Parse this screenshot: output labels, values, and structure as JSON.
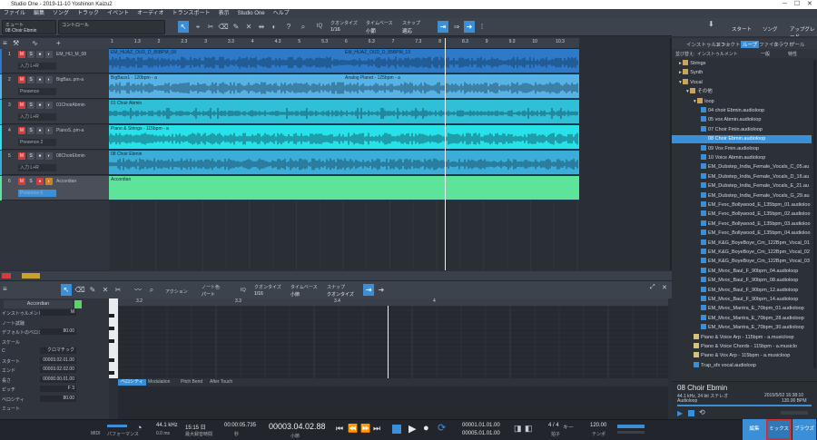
{
  "window": {
    "title": "Studio One - 2019-11-10 Yoshinon Kaizu2"
  },
  "menu": [
    "ファイル",
    "編集",
    "ソング",
    "トラック",
    "イベント",
    "オーディオ",
    "トランスポート",
    "表示",
    "Studio One",
    "ヘルプ"
  ],
  "toolbar": {
    "mute_label": "ミュート",
    "track_name": "08 Choir Ebmin",
    "control_label": "コントロール",
    "quantize_label": "クオンタイズ",
    "quantize_value": "1/16",
    "timebase_label": "タイムベース",
    "timebase_value": "小節",
    "snap_label": "スナップ",
    "snap_value": "適応"
  },
  "right_head": {
    "start": "スタート",
    "song": "ソング",
    "upgrade": "アップグレード"
  },
  "ruler_ticks": [
    "1",
    "1.3",
    "2",
    "2.3",
    "3",
    "3.3",
    "4",
    "4.3",
    "5",
    "5.3",
    "6",
    "6.3",
    "7",
    "7.3",
    "8",
    "8.3",
    "9",
    "9.3",
    "10",
    "10.3",
    "11"
  ],
  "tracks": [
    {
      "num": "1",
      "name": "EM_HIJ_M_08",
      "sub": "入力 L+R"
    },
    {
      "num": "2",
      "name": "BigBas..pm-a",
      "sub": "Presence"
    },
    {
      "num": "3",
      "name": "01ChoirAbmin",
      "sub": "入力 L+R"
    },
    {
      "num": "4",
      "name": "PianoS..pm-a",
      "sub": "Presence 2"
    },
    {
      "num": "5",
      "name": "08ChoirEbmin",
      "sub": "入力 L+R"
    },
    {
      "num": "6",
      "name": "Accordian",
      "sub": "Presence 6"
    }
  ],
  "clips": [
    {
      "label": "EM_HIJAZ_OUD_D_85BPM_08",
      "label2": "EM_HIJAZ_OUD_D_85BPM_19",
      "color": "#2f79c9"
    },
    {
      "label": "BigBass1 - 120bpm - a",
      "label2": "Analog Planet - 125bpm - a",
      "color": "#57b3e6"
    },
    {
      "label": "01 Choir Abmin",
      "label2": "",
      "color": "#2fc0d8"
    },
    {
      "label": "Piano & Strings - 115bpm - a",
      "label2": "",
      "color": "#28e2ea"
    },
    {
      "label": "08 Choir Ebmin",
      "label2": "",
      "color": "#3aaed8"
    },
    {
      "label": "Accordian",
      "label2": "",
      "color": "#5de39a"
    }
  ],
  "editor": {
    "instrument_name": "Accordian",
    "tool_labels": {
      "action": "アクション",
      "note_color": "ノート色",
      "note_color_val": "パート",
      "quantize": "クオンタイズ",
      "quantize_val": "1/16",
      "timebase": "タイムベース",
      "timebase_val": "小節",
      "snap": "スナップ",
      "snap_val": "クオンタイズ"
    },
    "ruler": [
      "3.2",
      "3.3",
      "3.4",
      "4"
    ],
    "props": [
      {
        "label": "インストゥルメント",
        "value": "M"
      },
      {
        "label": "ノート試聴",
        "value": ""
      },
      {
        "label": "デフォルトのベロシティ",
        "value": "80.00"
      },
      {
        "label": "スケール",
        "value": ""
      },
      {
        "label": "C",
        "value": "クロマチック"
      },
      {
        "label": "スタート",
        "value": "00003.02.01.00"
      },
      {
        "label": "エンド",
        "value": "00003.02.02.00"
      },
      {
        "label": "長さ",
        "value": "00000.00.01.00"
      },
      {
        "label": "ピッチ",
        "value": "F 3"
      },
      {
        "label": "ベロシティ",
        "value": "80.00"
      },
      {
        "label": "ミュート",
        "value": ""
      }
    ],
    "vel_tabs": [
      "ベロシティ",
      "Modulation",
      "Pitch Bend",
      "After Touch"
    ]
  },
  "browser": {
    "tabs": [
      "インストゥルメント",
      "エフェクト",
      "ループ",
      "ファイル",
      "クラウド",
      "プール"
    ],
    "filter": [
      "並び替え:",
      "インストゥルメント",
      "一般",
      "特性"
    ],
    "items": [
      {
        "label": "Strings",
        "type": "folder",
        "indent": 1
      },
      {
        "label": "Synth",
        "type": "folder",
        "indent": 1
      },
      {
        "label": "Vocal",
        "type": "folder-open",
        "indent": 1
      },
      {
        "label": "その他",
        "type": "folder-open",
        "indent": 2
      },
      {
        "label": "loop",
        "type": "folder-open",
        "indent": 3
      },
      {
        "label": "04 choir Ebmin.audioloop",
        "type": "file",
        "indent": 4
      },
      {
        "label": "05 vox Abmin.audioloop",
        "type": "file",
        "indent": 4
      },
      {
        "label": "07 Choir Fmin.audioloop",
        "type": "file",
        "indent": 4
      },
      {
        "label": "08 Choir Ebmin.audioloop",
        "type": "file",
        "indent": 4,
        "selected": true
      },
      {
        "label": "09 Vox Fmin.audioloop",
        "type": "file",
        "indent": 4
      },
      {
        "label": "10 Voice Abmin.audioloop",
        "type": "file",
        "indent": 4
      },
      {
        "label": "EM_Dubstep_India_Female_Vocals_C_05.au",
        "type": "file",
        "indent": 4
      },
      {
        "label": "EM_Dubstep_India_Female_Vocals_D_16.au",
        "type": "file",
        "indent": 4
      },
      {
        "label": "EM_Dubstep_India_Female_Vocals_E_21.au",
        "type": "file",
        "indent": 4
      },
      {
        "label": "EM_Dubstep_India_Female_Vocals_G_29.au",
        "type": "file",
        "indent": 4
      },
      {
        "label": "EM_Fvoc_Bollywood_E_135bpm_01.audioloo",
        "type": "file",
        "indent": 4
      },
      {
        "label": "EM_Fvoc_Bollywood_E_135bpm_02.audioloo",
        "type": "file",
        "indent": 4
      },
      {
        "label": "EM_Fvoc_Bollywood_E_135bpm_03.audioloo",
        "type": "file",
        "indent": 4
      },
      {
        "label": "EM_Fvoc_Bollywood_E_135bpm_04.audioloo",
        "type": "file",
        "indent": 4
      },
      {
        "label": "EM_K&G_BoyeBoye_Cm_122Bpm_Vocal_01",
        "type": "file",
        "indent": 4
      },
      {
        "label": "EM_K&G_BoyeBoye_Cm_122Bpm_Vocal_02",
        "type": "file",
        "indent": 4
      },
      {
        "label": "EM_K&G_BoyeBoye_Cm_122Bpm_Vocal_03",
        "type": "file",
        "indent": 4
      },
      {
        "label": "EM_Mvoc_Baul_F_90bpm_04.audioloop",
        "type": "file",
        "indent": 4
      },
      {
        "label": "EM_Mvoc_Baul_F_90bpm_08.audioloop",
        "type": "file",
        "indent": 4
      },
      {
        "label": "EM_Mvoc_Baul_F_90bpm_12.audioloop",
        "type": "file",
        "indent": 4
      },
      {
        "label": "EM_Mvoc_Baul_F_90bpm_14.audioloop",
        "type": "file",
        "indent": 4
      },
      {
        "label": "EM_Mvoc_Mantra_E_70bpm_01.audioloop",
        "type": "file",
        "indent": 4
      },
      {
        "label": "EM_Mvoc_Mantra_E_70bpm_28.audioloop",
        "type": "file",
        "indent": 4
      },
      {
        "label": "EM_Mvoc_Mantra_E_70bpm_30.audioloop",
        "type": "file",
        "indent": 4
      },
      {
        "label": "Piano & Voice Arp - 115bpm - a.musicloop",
        "type": "music",
        "indent": 3
      },
      {
        "label": "Piano & Voice Chords - 115bpm - a.musiclo",
        "type": "music",
        "indent": 3
      },
      {
        "label": "Piano & Vox Arp - 115bpm - a.musicloop",
        "type": "music",
        "indent": 3
      },
      {
        "label": "Trap_sfx vocal.audioloop",
        "type": "file",
        "indent": 3
      }
    ],
    "info": {
      "name": "08 Choir Ebmin",
      "spec": "44.1 kHz, 24 bit ステレオ",
      "date": "2015/5/02 16:38:10",
      "owner": "Audioloop",
      "bpm": "130.00 BPM"
    }
  },
  "transport": {
    "midi_label": "MIDI",
    "perf_label": "パフォーマンス",
    "sample_rate": "44.1 kHz",
    "latency": "0.0 ms",
    "time": "15:15 日",
    "time_label": "最大録音時間",
    "seconds": "00:00:05.735",
    "seconds_label": "秒",
    "position": "00003.04.02.88",
    "position_label": "小節",
    "loop_start": "00001.01.01.00",
    "loop_end": "00005.01.01.00",
    "signature": "4 / 4",
    "sig_label": "拍子",
    "tempo": "120.00",
    "tempo_label": "テンポ",
    "key_label": "キー"
  },
  "pages": {
    "edit": "編集",
    "mix": "ミックス",
    "browse": "ブラウズ"
  },
  "colors": {
    "accent": "#3a8fd6",
    "mute": "#d33c3c",
    "mix_highlight": "#d32f2f"
  }
}
